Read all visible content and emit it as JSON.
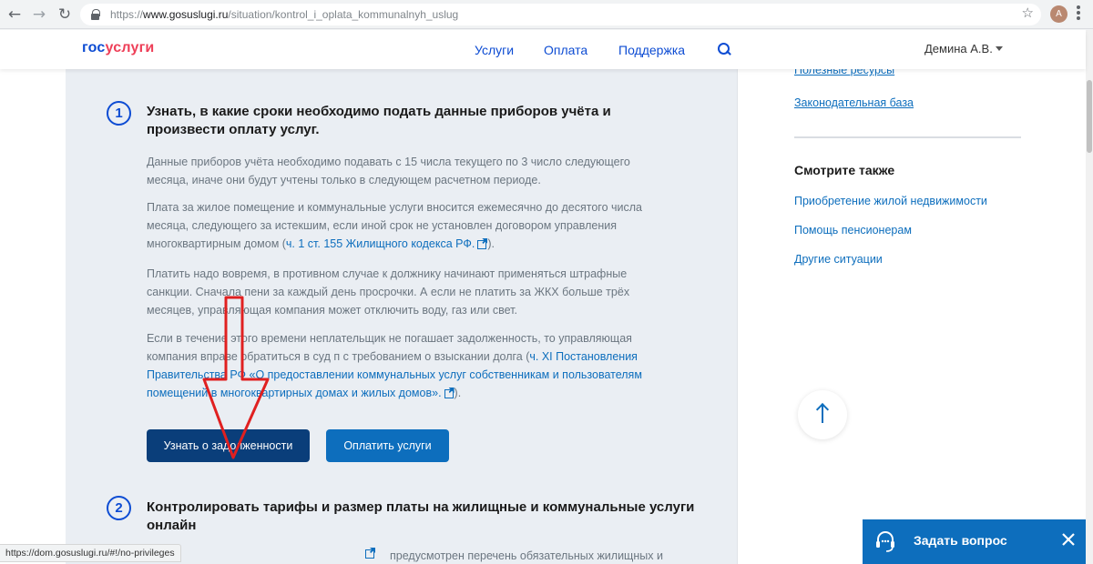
{
  "browser": {
    "url_prefix": "https://",
    "url_domain": "www.gosuslugi.ru",
    "url_path": "/situation/kontrol_i_oplata_kommunalnyh_uslug",
    "profile_initial": "А"
  },
  "header": {
    "logo_part1": "гос",
    "logo_part2": "услуги",
    "nav": [
      "Услуги",
      "Оплата",
      "Поддержка"
    ],
    "user_name": "Демина А.В."
  },
  "step1": {
    "number": "1",
    "title_line1": "Узнать, в какие сроки необходимо подать данные приборов учёта и",
    "title_line2": "произвести оплату услуг.",
    "p1": "Данные приборов учёта необходимо подавать с 15 числа текущего по 3 число следующего месяца, иначе они будут учтены только в следующем расчетном периоде.",
    "p2_text": "Плата за жилое помещение и коммунальные услуги вносится ежемесячно до десятого числа месяца, следующего за истекшим, если иной срок не установлен договором управления многоквартирным домом (",
    "p2_link": "ч. 1 ст. 155 Жилищного кодекса РФ.",
    "p2_end": ").",
    "p3": "Платить надо вовремя, в противном случае к должнику начинают применяться штрафные санкции. Сначала пени за каждый день просрочки. А если не платить за ЖКХ больше трёх месяцев, управляющая компания может отключить воду, газ или свет.",
    "p4_text": "Если в течение этого времени неплательщик не погашает задолженность, то управляющая компания вправе обратиться в суд п с требованием о взыскании долга (",
    "p4_link": "ч. XI Постановления Правительства РФ «О предоставлении коммунальных услуг собственникам и пользователям помещений в многоквартирных домах и жилых домов».",
    "p4_end": ").",
    "btn_debt": "Узнать о задолженности",
    "btn_pay": "Оплатить услуги"
  },
  "step2": {
    "number": "2",
    "title_line1": "Контролировать тарифы и размер платы на жилищные и коммунальные услуги",
    "title_line2": "онлайн",
    "cut_text": "предусмотрен перечень обязательных жилищных и"
  },
  "sidebar": {
    "link_resources": "Полезные ресурсы",
    "link_law": "Законодательная база",
    "see_also": "Смотрите также",
    "see_also_links": [
      "Приобретение жилой недвижимости",
      "Помощь пенсионерам",
      "Другие ситуации"
    ]
  },
  "widgets": {
    "ask_question": "Задать вопрос",
    "status_url": "https://dom.gosuslugi.ru/#!/no-privileges"
  },
  "colors": {
    "brand_blue": "#0d4cd3",
    "brand_red": "#ee3f58",
    "link_blue": "#0d6ebd",
    "annotation_red": "#e02020"
  }
}
